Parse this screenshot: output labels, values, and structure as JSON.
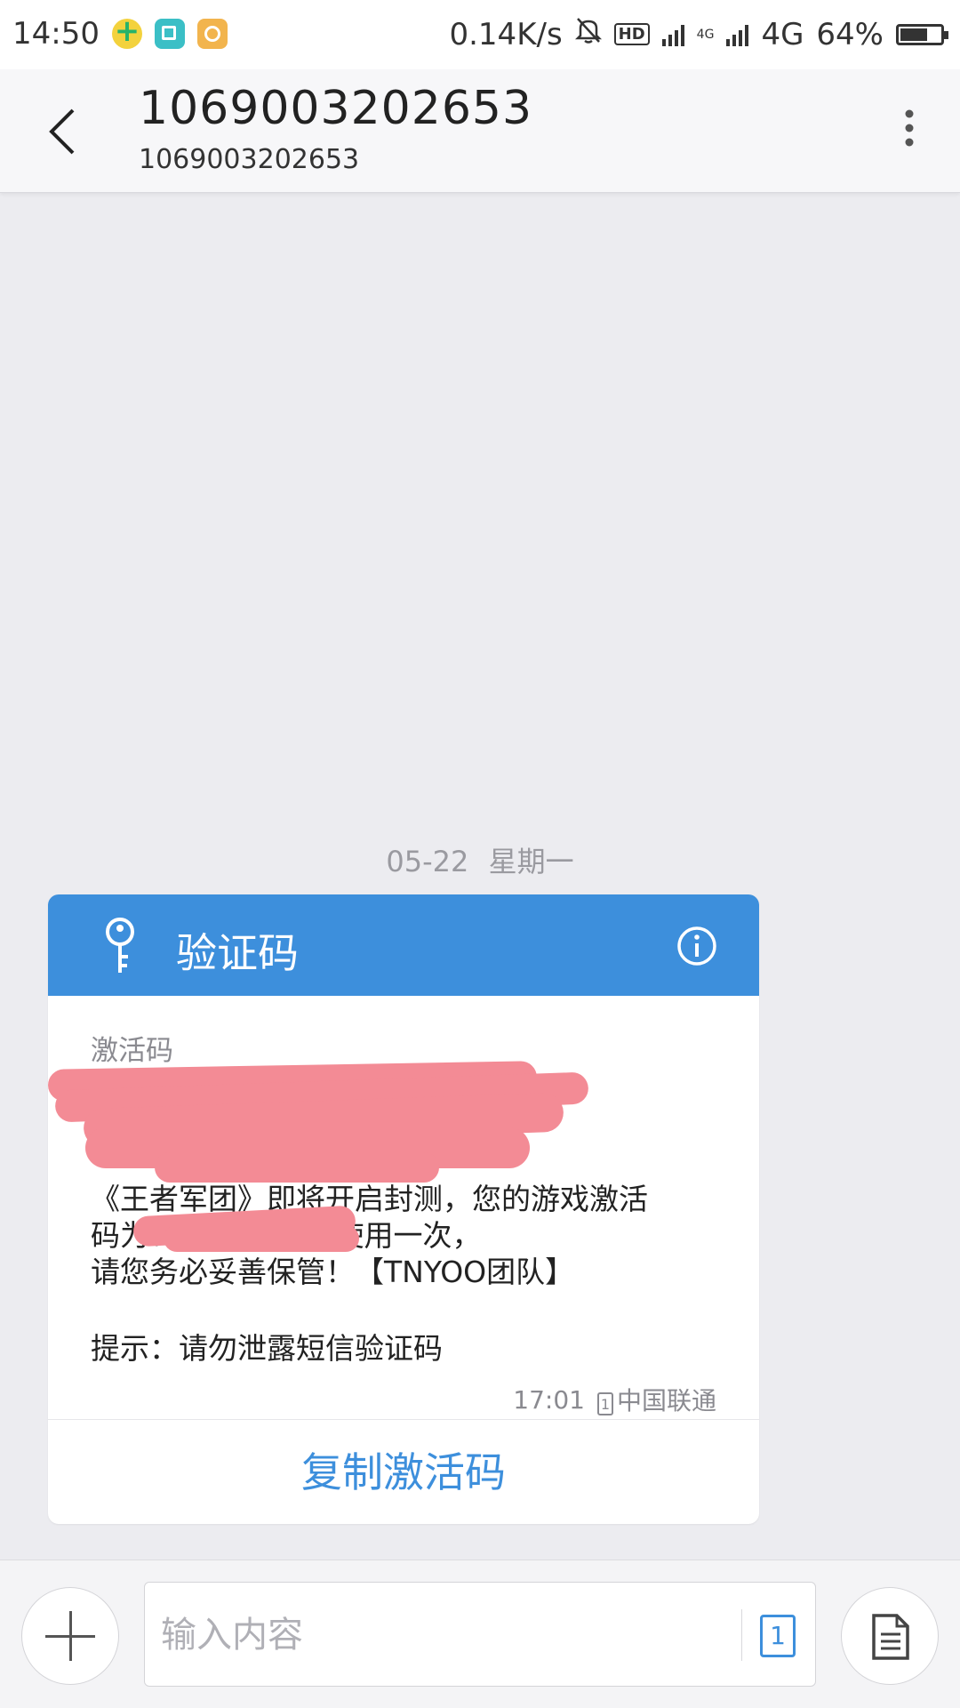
{
  "status_bar": {
    "time": "14:50",
    "net_speed": "0.14K/s",
    "hd": "HD",
    "network": "4G",
    "network_small": "4G",
    "battery": "64%"
  },
  "header": {
    "title": "1069003202653",
    "subtitle": "1069003202653"
  },
  "date_separator": {
    "date": "05-22",
    "weekday": "星期一"
  },
  "card": {
    "title": "验证码",
    "label": "激活码",
    "body": "《王者军团》即将开启封测，您的游戏激活\n码为：                                    激活码只能使用一次，\n请您务必妥善保管！【TNYOO团队】",
    "tip": "提示：请勿泄露短信验证码",
    "time": "17:01",
    "sim_slot": "1",
    "carrier": "中国联通",
    "copy_button": "复制激活码"
  },
  "compose": {
    "placeholder": "输入内容",
    "sim_slot": "1"
  }
}
